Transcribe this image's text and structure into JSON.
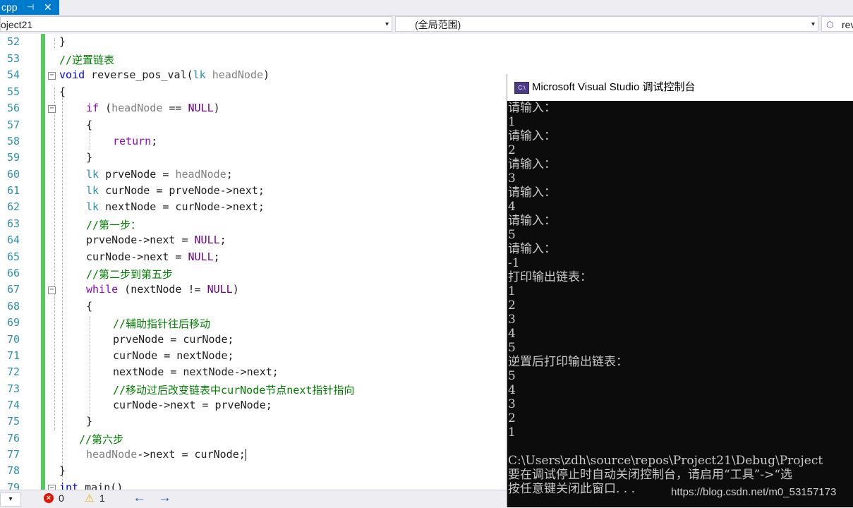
{
  "tab": {
    "name": "cpp",
    "pin": "⊣",
    "close": "✕"
  },
  "nav": {
    "project": "oject21",
    "scope": "(全局范围)",
    "member": "rev",
    "member_icon": "method-icon",
    "dropdown_arrow": "▾"
  },
  "editor": {
    "line_numbers": [
      "52",
      "53",
      "54",
      "55",
      "56",
      "57",
      "58",
      "59",
      "60",
      "61",
      "62",
      "63",
      "64",
      "65",
      "66",
      "67",
      "68",
      "69",
      "70",
      "71",
      "72",
      "73",
      "74",
      "75",
      "76",
      "77",
      "78",
      "79"
    ],
    "fold_glyph": "−",
    "code": {
      "l52": "}",
      "l53": "//逆置链表",
      "l54_kw": "void",
      "l54_fn": " reverse_pos_val(",
      "l54_ty": "lk",
      "l54_param": " headNode",
      "l54_end": ")",
      "l55": "{",
      "l56_kw": "if",
      "l56_a": " (",
      "l56_p": "headNode",
      "l56_b": " == ",
      "l56_m": "NULL",
      "l56_c": ")",
      "l57": "{",
      "l58_kw": "return",
      "l58_end": ";",
      "l59": "}",
      "l60_ty": "lk",
      "l60_a": " prveNode = ",
      "l60_p": "headNode",
      "l60_b": ";",
      "l61_ty": "lk",
      "l61_a": " curNode = prveNode->next;",
      "l62_ty": "lk",
      "l62_a": " nextNode = curNode->next;",
      "l63": "//第一步：",
      "l64_a": "prveNode->next = ",
      "l64_m": "NULL",
      "l64_b": ";",
      "l65_a": "curNode->next = ",
      "l65_m": "NULL",
      "l65_b": ";",
      "l66": "//第二步到第五步",
      "l67_kw": "while",
      "l67_a": " (nextNode != ",
      "l67_m": "NULL",
      "l67_b": ")",
      "l68": "{",
      "l69": "//辅助指针往后移动",
      "l70": "prveNode = curNode;",
      "l71": "curNode = nextNode;",
      "l72": "nextNode = nextNode->next;",
      "l73": "//移动过后改变链表中curNode节点next指针指向",
      "l74": "curNode->next = prveNode;",
      "l75": "}",
      "l76": "//第六步",
      "l77_p": "headNode",
      "l77_a": "->next = curNode;",
      "l78": "}",
      "l79_kw": "int",
      "l79_a": " main()"
    }
  },
  "status": {
    "zoom_arrow": "▾",
    "error_icon": "error-icon",
    "errors": "0",
    "warning_icon": "warning-icon",
    "warnings": "1",
    "back": "←",
    "forward": "→"
  },
  "console": {
    "icon_text": "C:\\",
    "title": "Microsoft Visual Studio 调试控制台",
    "lines": [
      "请输入：",
      "1",
      "请输入：",
      "2",
      "请输入：",
      "3",
      "请输入：",
      "4",
      "请输入：",
      "5",
      "请输入：",
      "-1",
      "打印输出链表：",
      "1",
      "2",
      "3",
      "4",
      "5",
      "逆置后打印输出链表：",
      "5",
      "4",
      "3",
      "2",
      "1",
      "",
      "C:\\Users\\zdh\\source\\repos\\Project21\\Debug\\Project",
      "要在调试停止时自动关闭控制台，请启用“工具”->“选",
      "按任意键关闭此窗口. . ."
    ],
    "watermark": "https://blog.csdn.net/m0_53157173"
  }
}
